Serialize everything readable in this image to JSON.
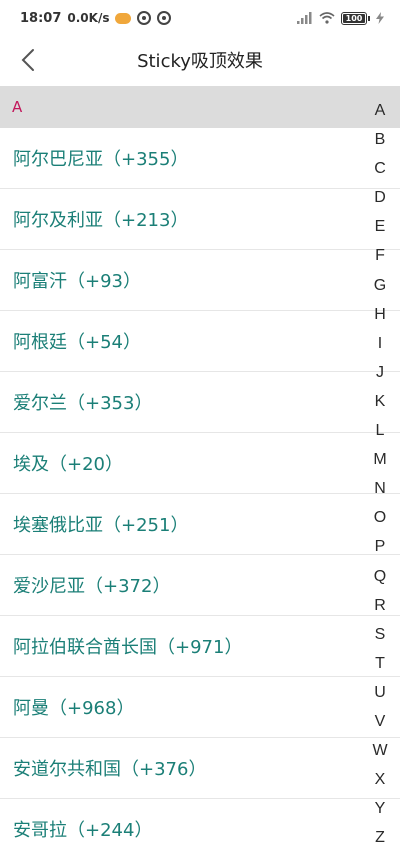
{
  "status_bar": {
    "time": "18:07",
    "network_speed": "0.0K/s",
    "battery_level": "100",
    "icons": [
      "cloud-icon",
      "sync-icon",
      "sync-icon",
      "signal-icon",
      "wifi-icon",
      "battery-icon",
      "charging-icon"
    ]
  },
  "toolbar": {
    "title": "Sticky吸顶效果",
    "back_icon": "chevron-left-icon"
  },
  "sticky_header": {
    "letter": "A"
  },
  "list": {
    "items": [
      "阿尔巴尼亚（+355）",
      "阿尔及利亚（+213）",
      "阿富汗（+93）",
      "阿根廷（+54）",
      "爱尔兰（+353）",
      "埃及（+20）",
      "埃塞俄比亚（+251）",
      "爱沙尼亚（+372）",
      "阿拉伯联合酋长国（+971）",
      "阿曼（+968）",
      "安道尔共和国（+376）",
      "安哥拉（+244）"
    ]
  },
  "index_bar": {
    "letters": [
      "A",
      "B",
      "C",
      "D",
      "E",
      "F",
      "G",
      "H",
      "I",
      "J",
      "K",
      "L",
      "M",
      "N",
      "O",
      "P",
      "Q",
      "R",
      "S",
      "T",
      "U",
      "V",
      "W",
      "X",
      "Y",
      "Z"
    ]
  },
  "colors": {
    "item_text": "#1b7f77",
    "header_bg": "#dcdcdc",
    "header_text": "#c2185b"
  }
}
